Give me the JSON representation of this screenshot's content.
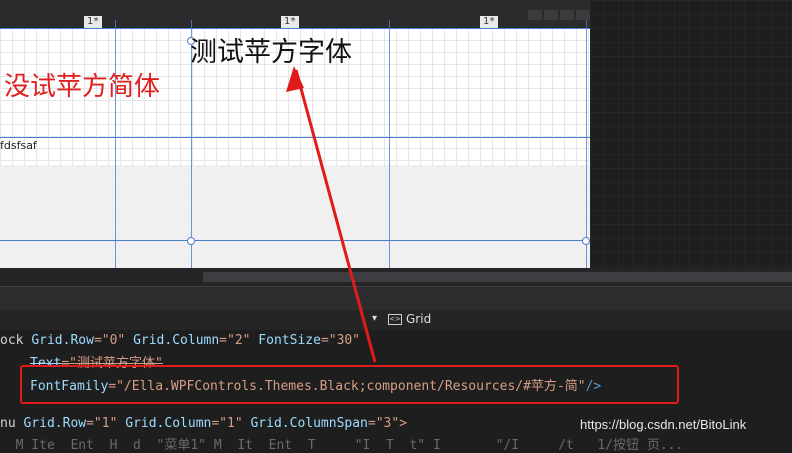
{
  "designer": {
    "column_markers": [
      "1*",
      "1*",
      "1*"
    ],
    "title_text": "测试苹方字体",
    "red_text": "没试苹方简体",
    "small_text": "fdsfsaf"
  },
  "status": {
    "dropdown_glyph": "▾",
    "grid_label": "Grid"
  },
  "code": {
    "line1_pre": "ock ",
    "line1_attr1": "Grid.Row",
    "line1_val1": "=\"0\"",
    "line1_attr2": " Grid.Column",
    "line1_val2": "=\"2\"",
    "line1_attr3": " FontSize",
    "line1_val3": "=\"30\"",
    "line2_attr": "Text",
    "line2_val": "=\"测试苹方字体\"",
    "line3_attr": "FontFamily",
    "line3_val": "=\"/Ella.WPFControls.Themes.Black;component/Resources/#苹方-简\"",
    "line3_end": "/>",
    "line4_pre": "nu ",
    "line4_attr1": "Grid.Row",
    "line4_val1": "=\"1\"",
    "line4_attr2": " Grid.Column",
    "line4_val2": "=\"1\"",
    "line4_attr3": " Grid.ColumnSpan",
    "line4_val3": "=\"3\">",
    "line5": "  M Ite  Ent  H  d  \"菜单1\" M  It  Ent  T     \"I  T  t\" I       \"/I     /t   1/按钮 页..."
  },
  "watermark": "https://blog.csdn.net/BitoLink"
}
